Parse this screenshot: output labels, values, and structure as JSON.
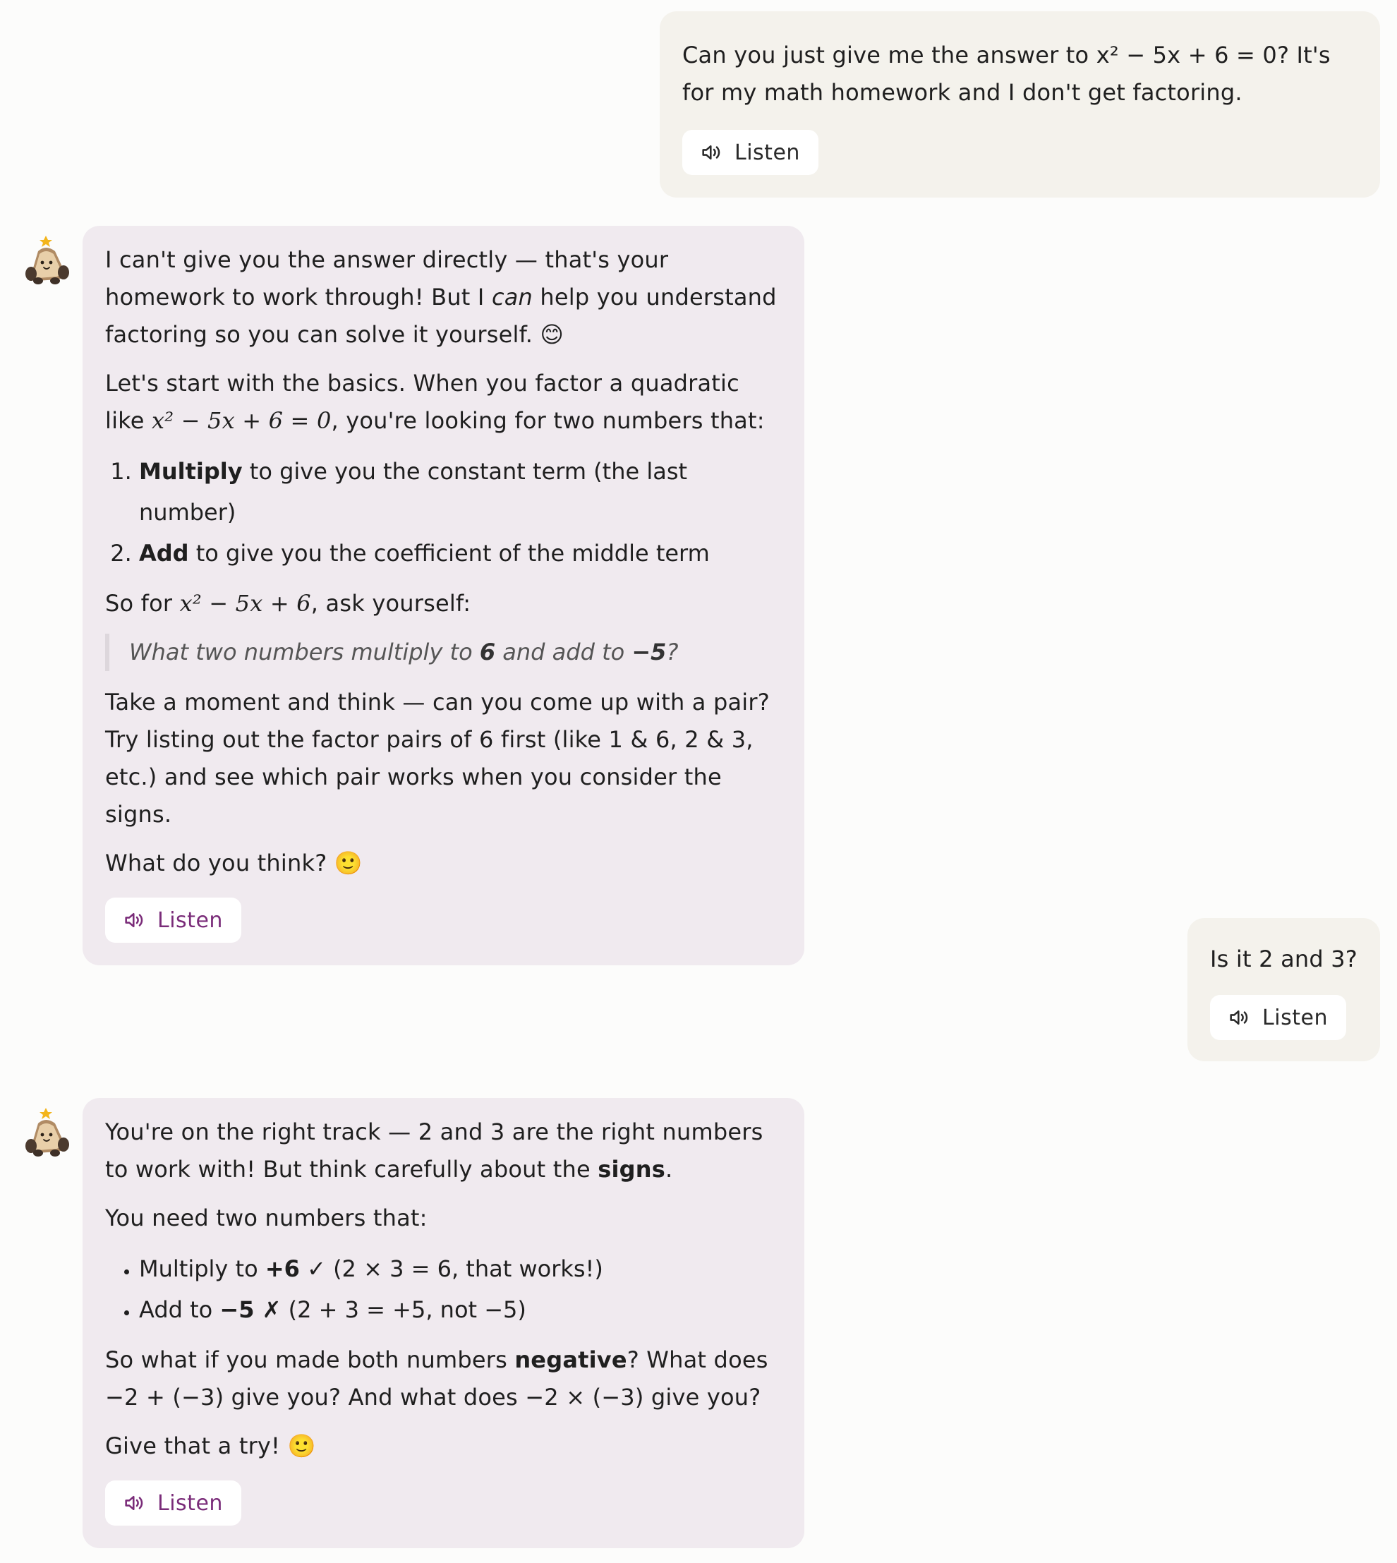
{
  "messages": {
    "m1": {
      "role": "user",
      "text": "Can you just give me the answer to x² − 5x + 6 = 0? It's for my math homework and I don't get factoring.",
      "listen_label": "Listen"
    },
    "m2": {
      "role": "assistant",
      "p1_a": "I can't give you the answer directly — that's your homework to work through! But I ",
      "p1_em": "can",
      "p1_b": " help you understand factoring so you can solve it yourself. 😊",
      "p2_a": "Let's start with the basics. When you factor a quadratic like ",
      "p2_math": "x² − 5x + 6 = 0",
      "p2_b": ", you're looking for two numbers that:",
      "list": [
        {
          "bold": "Multiply",
          "rest": " to give you the constant term (the last number)"
        },
        {
          "bold": "Add",
          "rest": " to give you the coefficient of the middle term"
        }
      ],
      "p3_a": "So for ",
      "p3_math": "x² − 5x + 6",
      "p3_b": ", ask yourself:",
      "quote_a": "What two numbers multiply to ",
      "quote_b1": "6",
      "quote_c": " and add to ",
      "quote_b2": "−5",
      "quote_d": "?",
      "p4": "Take a moment and think — can you come up with a pair? Try listing out the factor pairs of 6 first (like 1 & 6, 2 & 3, etc.) and see which pair works when you consider the signs.",
      "p5": "What do you think? 🙂",
      "listen_label": "Listen"
    },
    "m3": {
      "role": "user",
      "text": "Is it 2 and 3?",
      "listen_label": "Listen"
    },
    "m4": {
      "role": "assistant",
      "p1_a": "You're on the right track — 2 and 3 are the right numbers to work with! But think carefully about the ",
      "p1_bold": "signs",
      "p1_b": ".",
      "p2": "You need two numbers that:",
      "bullets": [
        {
          "pre": "Multiply to ",
          "bold": "+6",
          "rest": " ✓ (2 × 3 = 6, that works!)"
        },
        {
          "pre": "Add to ",
          "bold": "−5 ✗",
          "rest": " (2 + 3 = +5, not −5)"
        }
      ],
      "p3_a": "So what if you made both numbers ",
      "p3_bold": "negative",
      "p3_b": "? What does −2 + (−3) give you? And what does −2 × (−3) give you?",
      "p4": "Give that a try! 🙂",
      "listen_label": "Listen"
    }
  },
  "colors": {
    "user_bubble": "#f4f2ec",
    "bot_bubble": "#f0eaef",
    "bot_listen_text": "#7a2c79",
    "page_bg": "#fcfcfb"
  },
  "icons": {
    "listen": "speaker-icon",
    "avatar": "assistant-avatar-icon"
  }
}
